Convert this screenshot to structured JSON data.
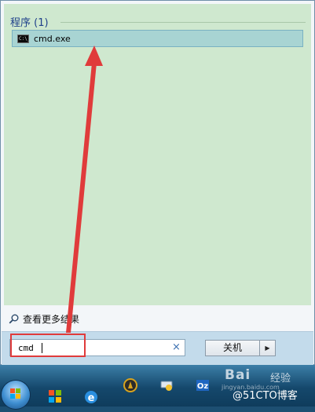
{
  "start_menu": {
    "section_title": "程序 (1)",
    "results": [
      {
        "label": "cmd.exe",
        "icon": "console-icon",
        "icon_text": "C:\\_"
      }
    ],
    "more_results_label": "查看更多结果",
    "search": {
      "value": "cmd",
      "clear_label": "×"
    },
    "shutdown_label": "关机",
    "shutdown_arrow": "▶"
  },
  "taskbar": {
    "icons": [
      "start-orb-icon",
      "windows-store-icon",
      "internet-explorer-icon",
      "app-icon",
      "network-icon",
      "outlook-icon"
    ]
  },
  "watermark": {
    "baidu_text": "Bai",
    "baidu_suffix": "经验",
    "url_text": "jingyan.baidu.com",
    "blog_text": "@51CTO博客"
  },
  "annotation_color": "#e03b3b",
  "highlight_color": "#a8d4d3"
}
